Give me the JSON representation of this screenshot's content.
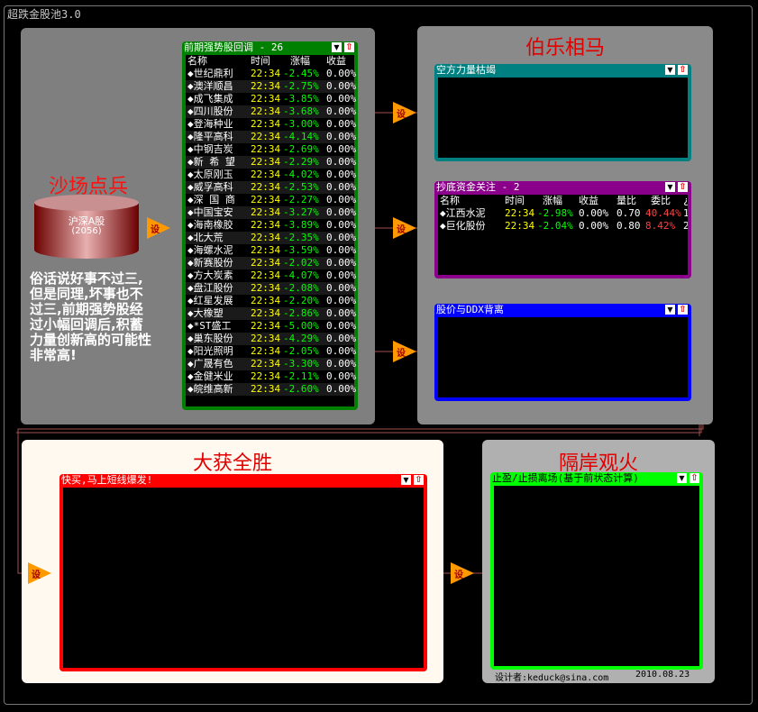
{
  "app": {
    "title": "超跌金股池3.0"
  },
  "panels": {
    "shachang": {
      "title": "沙场点兵",
      "db_label": "沪深A股",
      "db_count": "(2056)",
      "saying": [
        "俗话说好事不过三,",
        "但是同理,坏事也不",
        "过三,前期强势股经",
        "过小幅回调后,积蓄",
        "力量创新高的可能性",
        "非常高!"
      ]
    },
    "bole": {
      "title": "伯乐相马"
    },
    "dahuo": {
      "title": "大获全胜"
    },
    "gean": {
      "title": "隔岸观火"
    }
  },
  "filter_icon_label": "设",
  "control_icons": {
    "filter": "filter-icon",
    "up": "up-arrow-icon"
  },
  "main_table": {
    "header": "前期强势股回调 - 26",
    "columns": [
      "名称",
      "时间",
      "涨幅",
      "收益"
    ],
    "rows": [
      [
        "◆世纪鼎利",
        "22:34",
        "-2.45%",
        "0.00%"
      ],
      [
        "◆澳洋顺昌",
        "22:34",
        "-2.75%",
        "0.00%"
      ],
      [
        "◆成飞集成",
        "22:34",
        "-3.85%",
        "0.00%"
      ],
      [
        "◆四川股份",
        "22:34",
        "-3.68%",
        "0.00%"
      ],
      [
        "◆登海种业",
        "22:34",
        "-3.00%",
        "0.00%"
      ],
      [
        "◆隆平高科",
        "22:34",
        "-4.14%",
        "0.00%"
      ],
      [
        "◆中钢吉炭",
        "22:34",
        "-2.69%",
        "0.00%"
      ],
      [
        "◆新 希 望",
        "22:34",
        "-2.29%",
        "0.00%"
      ],
      [
        "◆太原刚玉",
        "22:34",
        "-4.02%",
        "0.00%"
      ],
      [
        "◆威孚高科",
        "22:34",
        "-2.53%",
        "0.00%"
      ],
      [
        "◆深 国 商",
        "22:34",
        "-2.27%",
        "0.00%"
      ],
      [
        "◆中国宝安",
        "22:34",
        "-3.27%",
        "0.00%"
      ],
      [
        "◆海南橡胶",
        "22:34",
        "-3.89%",
        "0.00%"
      ],
      [
        "◆北大荒",
        "22:34",
        "-2.35%",
        "0.00%"
      ],
      [
        "◆海螺水泥",
        "22:34",
        "-3.59%",
        "0.00%"
      ],
      [
        "◆新赛股份",
        "22:34",
        "-2.02%",
        "0.00%"
      ],
      [
        "◆方大炭素",
        "22:34",
        "-4.07%",
        "0.00%"
      ],
      [
        "◆盘江股份",
        "22:34",
        "-2.08%",
        "0.00%"
      ],
      [
        "◆红星发展",
        "22:34",
        "-2.20%",
        "0.00%"
      ],
      [
        "◆大橡塑",
        "22:34",
        "-2.86%",
        "0.00%"
      ],
      [
        "◆*ST盛工",
        "22:34",
        "-5.00%",
        "0.00%"
      ],
      [
        "◆巢东股份",
        "22:34",
        "-4.29%",
        "0.00%"
      ],
      [
        "◆阳光照明",
        "22:34",
        "-2.05%",
        "0.00%"
      ],
      [
        "◆广晟有色",
        "22:34",
        "-3.30%",
        "0.00%"
      ],
      [
        "◆金健米业",
        "22:34",
        "-2.11%",
        "0.00%"
      ],
      [
        "◆皖维高新",
        "22:34",
        "-2.60%",
        "0.00%"
      ]
    ]
  },
  "windows": {
    "kong": {
      "header": "空方力量枯竭"
    },
    "chaodi": {
      "header": "抄底资金关注 - 2",
      "columns": [
        "名称",
        "时间",
        "涨幅",
        "收益",
        "量比",
        "委比",
        "¿"
      ],
      "rows": [
        [
          "◆江西水泥",
          "22:34",
          "-2.98%",
          "0.00%",
          "0.70",
          "40.44%",
          "1"
        ],
        [
          "◆巨化股份",
          "22:34",
          "-2.04%",
          "0.00%",
          "0.80",
          "8.42%",
          "2"
        ]
      ]
    },
    "ddx": {
      "header": "股价与DDX背离"
    },
    "kuaimai": {
      "header": "快买,马上短线爆发!"
    },
    "zhiying": {
      "header": "止盈/止损离场(基于前状态计算)"
    }
  },
  "footer": {
    "designer": "设计者:keduck@sina.com",
    "date": "2010.08.23"
  },
  "colors": {
    "green_frame": "#008000",
    "teal_frame": "#008080",
    "purple_frame": "#8b008b",
    "blue_frame": "#0000ff",
    "red_frame": "#ff0000",
    "lime_frame": "#00ff00",
    "down": "#00ff00",
    "time": "#ffff00",
    "title_red": "#e00000"
  }
}
